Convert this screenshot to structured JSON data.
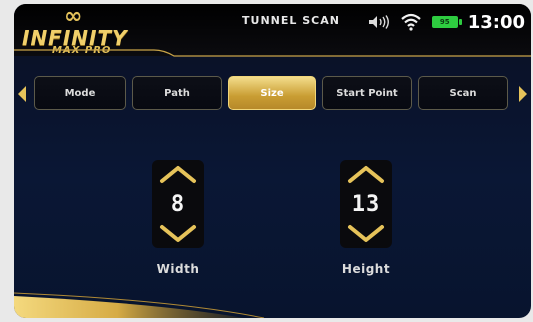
{
  "header": {
    "logo_main": "INFINITY",
    "logo_sub": "MAX PRO",
    "logo_symbol": "∞",
    "screen_title": "TUNNEL SCAN",
    "battery_level": "95",
    "time": "13:00"
  },
  "tabs": {
    "items": [
      {
        "label": "Mode"
      },
      {
        "label": "Path"
      },
      {
        "label": "Size",
        "active": true
      },
      {
        "label": "Start Point"
      },
      {
        "label": "Scan"
      }
    ]
  },
  "size": {
    "width": {
      "value": "8",
      "label": "Width"
    },
    "height": {
      "value": "13",
      "label": "Height"
    }
  },
  "colors": {
    "gold": "#e6c35a",
    "active_tab": "#c99d33",
    "background": "#0a1735",
    "battery": "#2ecc40"
  },
  "icons": [
    "speaker-icon",
    "wifi-icon",
    "battery-icon",
    "chevron-up-icon",
    "chevron-down-icon",
    "arrow-left-icon",
    "arrow-right-icon"
  ]
}
